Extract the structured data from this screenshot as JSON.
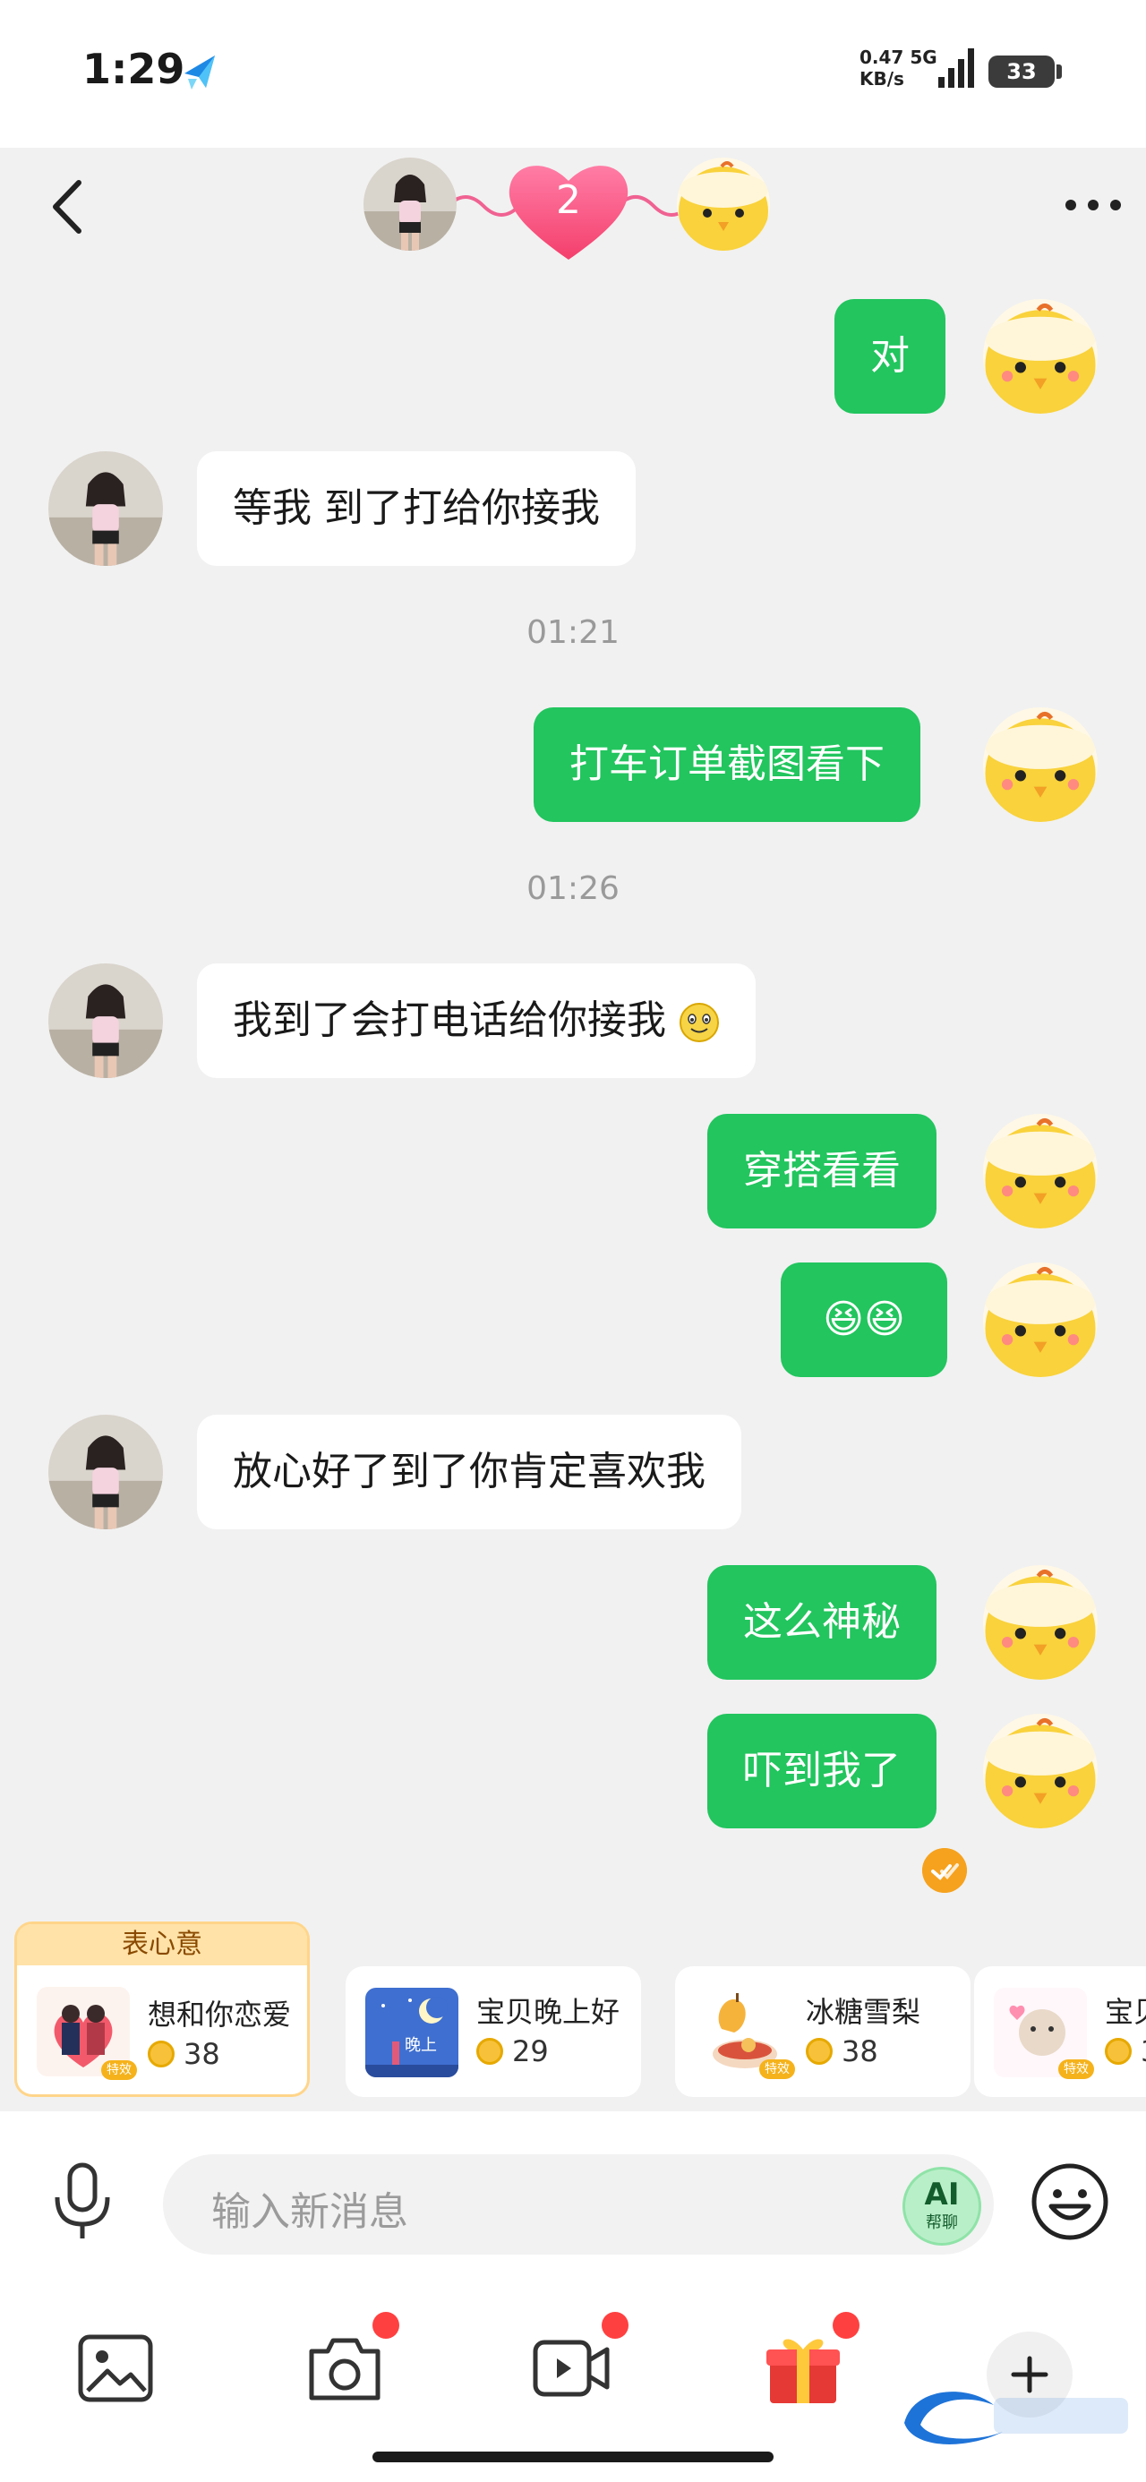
{
  "status_bar": {
    "time": "1:29",
    "network_speed": "0.47",
    "network_speed_unit": "KB/s",
    "network_type": "5G",
    "battery": "33"
  },
  "header": {
    "intimacy_level": "2",
    "back_icon": "chevron-left-icon",
    "more_icon": "more-horizontal-icon"
  },
  "messages": [
    {
      "type": "me",
      "text": "对"
    },
    {
      "type": "her",
      "text": "等我 到了打给你接我"
    },
    {
      "type": "time",
      "text": "01:21"
    },
    {
      "type": "me",
      "text": "打车订单截图看下"
    },
    {
      "type": "time",
      "text": "01:26"
    },
    {
      "type": "her",
      "text": "我到了会打电话给你接我"
    },
    {
      "type": "me",
      "text": "穿搭看看"
    },
    {
      "type": "me",
      "text": "😆😆"
    },
    {
      "type": "her",
      "text": "放心好了到了你肯定喜欢我"
    },
    {
      "type": "me",
      "text": "这么神秘"
    },
    {
      "type": "me",
      "text": "吓到我了"
    }
  ],
  "gifts": {
    "featured_title": "表心意",
    "tag_label": "特效",
    "items": [
      {
        "name": "想和你恋爱",
        "price": "38"
      },
      {
        "name": "宝贝晚上好",
        "price": "29"
      },
      {
        "name": "冰糖雪梨",
        "price": "38"
      },
      {
        "name": "宝贝",
        "price": "3"
      }
    ]
  },
  "input": {
    "placeholder": "输入新消息",
    "ai_label": "AI",
    "ai_sub": "帮聊"
  },
  "colors": {
    "my_bubble": "#22c55e",
    "her_bubble": "#ffffff",
    "background": "#f1f1f1",
    "badge": "#ff4040"
  }
}
